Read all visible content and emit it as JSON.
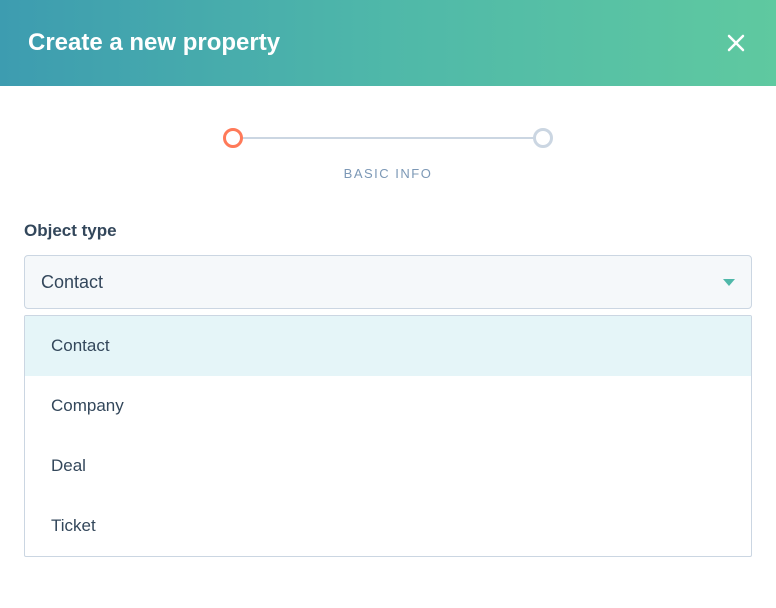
{
  "header": {
    "title": "Create a new property"
  },
  "stepper": {
    "label": "BASIC INFO"
  },
  "form": {
    "object_type_label": "Object type",
    "object_type_value": "Contact",
    "options": [
      {
        "label": "Contact",
        "highlighted": true
      },
      {
        "label": "Company",
        "highlighted": false
      },
      {
        "label": "Deal",
        "highlighted": false
      },
      {
        "label": "Ticket",
        "highlighted": false
      }
    ]
  }
}
